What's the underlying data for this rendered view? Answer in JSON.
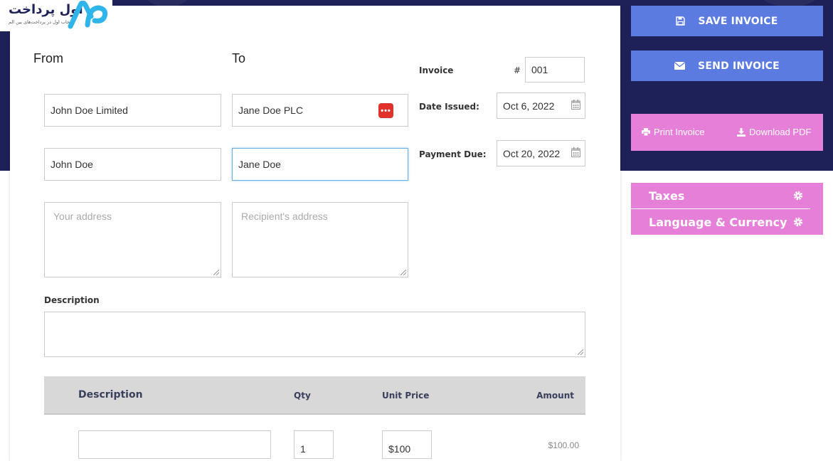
{
  "logo": {
    "text": "اول پرداخت",
    "tagline": "انتخاب اول در پرداخت‌های بین الم"
  },
  "invoice": {
    "from_label": "From",
    "to_label": "To",
    "from_company": "John Doe Limited",
    "to_company": "Jane Doe PLC",
    "from_name": "John Doe",
    "to_name": "Jane Doe",
    "from_address_placeholder": "Your address",
    "to_address_placeholder": "Recipient's address",
    "invoice_label": "Invoice",
    "hash": "#",
    "number": "001",
    "date_issued_label": "Date Issued:",
    "date_issued": "Oct 6, 2022",
    "payment_due_label": "Payment Due:",
    "payment_due": "Oct 20, 2022",
    "description_label": "Description"
  },
  "items_table": {
    "columns": [
      "Description",
      "Qty",
      "Unit Price",
      "Amount"
    ],
    "rows": [
      {
        "description": "",
        "qty": "1",
        "unit_price": "$100",
        "amount": "$100.00"
      }
    ]
  },
  "sidebar": {
    "save_label": "SAVE INVOICE",
    "send_label": "SEND INVOICE",
    "print_label": "Print Invoice",
    "download_label": "Download PDF",
    "taxes_label": "Taxes",
    "language_label": "Language & Currency"
  },
  "colors": {
    "navy": "#1e2157",
    "button_blue": "#5c7be0",
    "pink": "#e67fd8",
    "password_red": "#e0312a"
  }
}
